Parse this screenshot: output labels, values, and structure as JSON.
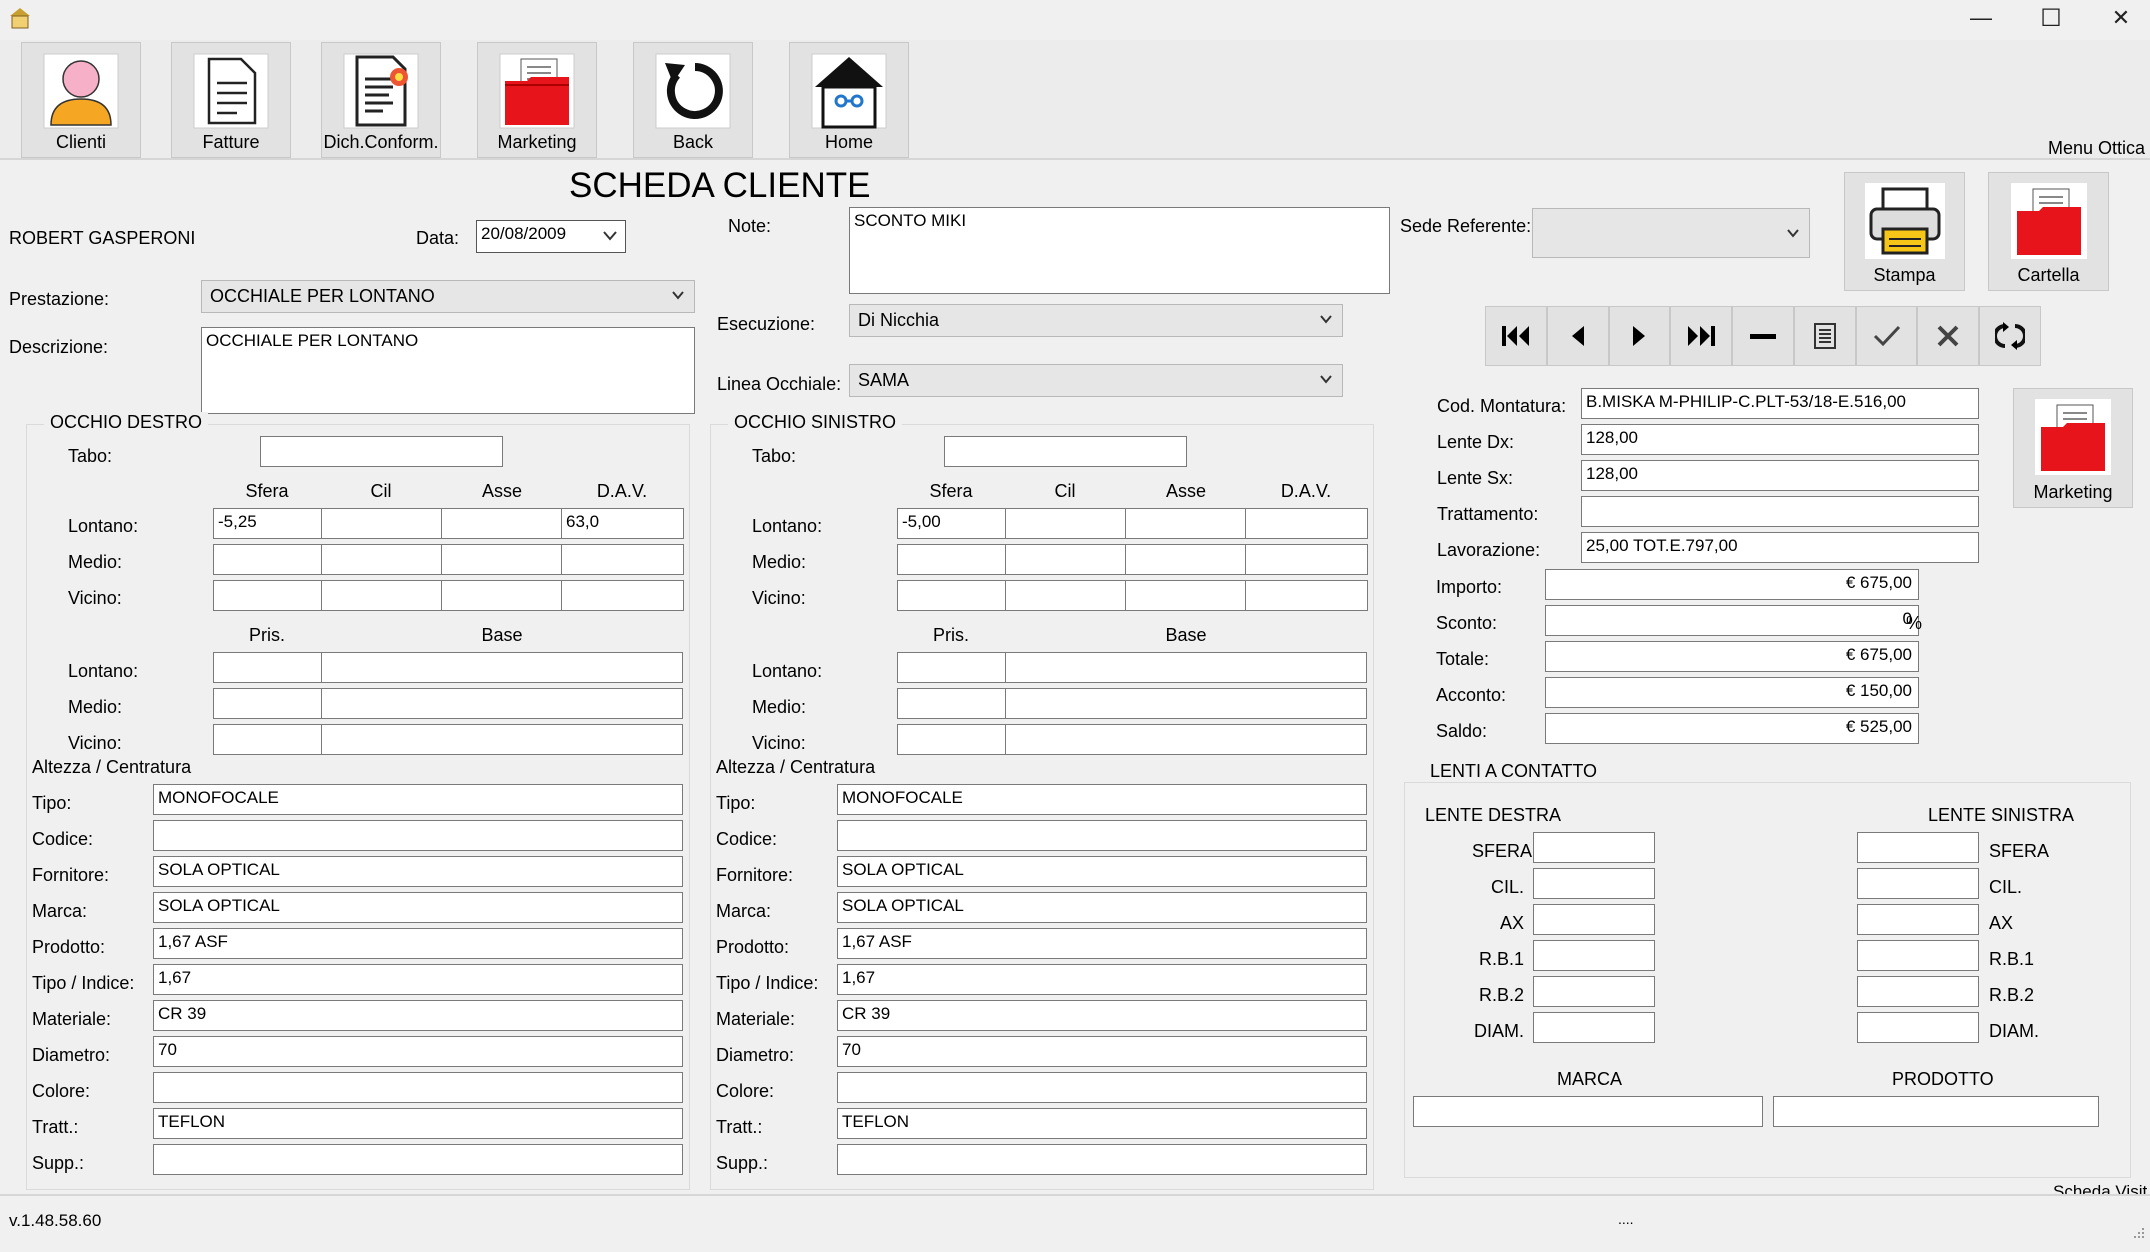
{
  "window": {
    "minimize": "—",
    "maximize": "☐",
    "close": "✕"
  },
  "toolbar": {
    "items": [
      {
        "label": "Clienti",
        "icon": "person-icon"
      },
      {
        "label": "Fatture",
        "icon": "document-icon"
      },
      {
        "label": "Dich.Conform.",
        "icon": "certificate-icon"
      },
      {
        "label": "Marketing",
        "icon": "folder-icon"
      },
      {
        "label": "Back",
        "icon": "undo-icon"
      },
      {
        "label": "Home",
        "icon": "home-icon"
      }
    ],
    "menu_label": "Menu Ottica"
  },
  "header": {
    "title": "SCHEDA CLIENTE",
    "customer": "ROBERT GASPERONI",
    "data_label": "Data:",
    "data_value": "20/08/2009",
    "note_label": "Note:",
    "note_value": "SCONTO MIKI",
    "sede_label": "Sede Referente:",
    "sede_value": ""
  },
  "prestazione": {
    "label": "Prestazione:",
    "value": "OCCHIALE PER LONTANO",
    "desc_label": "Descrizione:",
    "desc_value": "OCCHIALE PER LONTANO"
  },
  "esecuzione": {
    "label": "Esecuzione:",
    "value": "Di Nicchia"
  },
  "linea": {
    "label": "Linea Occhiale:",
    "value": "SAMA"
  },
  "buttons": {
    "stampa": "Stampa",
    "cartella": "Cartella",
    "marketing": "Marketing"
  },
  "eye_common": {
    "tabo": "Tabo:",
    "cols": [
      "Sfera",
      "Cil",
      "Asse",
      "D.A.V."
    ],
    "rows": [
      "Lontano:",
      "Medio:",
      "Vicino:"
    ],
    "cols2": [
      "Pris.",
      "Base"
    ],
    "altezza": "Altezza / Centratura",
    "fields": [
      "Tipo:",
      "Codice:",
      "Fornitore:",
      "Marca:",
      "Prodotto:",
      "Tipo / Indice:",
      "Materiale:",
      "Diametro:",
      "Colore:",
      "Tratt.:",
      "Supp.:"
    ]
  },
  "right_eye": {
    "title": "OCCHIO DESTRO",
    "tabo": "",
    "grid": [
      [
        "-5,25",
        "",
        "",
        "63,0"
      ],
      [
        "",
        "",
        "",
        ""
      ],
      [
        "",
        "",
        "",
        ""
      ]
    ],
    "grid2": [
      [
        "",
        ""
      ],
      [
        "",
        ""
      ],
      [
        "",
        ""
      ]
    ],
    "values": [
      "MONOFOCALE",
      "",
      "SOLA OPTICAL",
      "SOLA OPTICAL",
      "1,67 ASF",
      "1,67",
      "CR 39",
      "70",
      "",
      "TEFLON",
      ""
    ]
  },
  "left_eye": {
    "title": "OCCHIO SINISTRO",
    "tabo": "",
    "grid": [
      [
        "-5,00",
        "",
        "",
        ""
      ],
      [
        "",
        "",
        "",
        ""
      ],
      [
        "",
        "",
        "",
        ""
      ]
    ],
    "grid2": [
      [
        "",
        ""
      ],
      [
        "",
        ""
      ],
      [
        "",
        ""
      ]
    ],
    "values": [
      "MONOFOCALE",
      "",
      "SOLA OPTICAL",
      "SOLA OPTICAL",
      "1,67 ASF",
      "1,67",
      "CR 39",
      "70",
      "",
      "TEFLON",
      ""
    ]
  },
  "summary": {
    "labels": [
      "Cod. Montatura:",
      "Lente Dx:",
      "Lente Sx:",
      "Trattamento:",
      "Lavorazione:"
    ],
    "values": [
      "B.MISKA M-PHILIP-C.PLT-53/18-E.516,00",
      "128,00",
      "128,00",
      "",
      "25,00 TOT.E.797,00"
    ],
    "money_labels": [
      "Importo:",
      "Sconto:",
      "Totale:",
      "Acconto:",
      "Saldo:"
    ],
    "money_values": [
      "€ 675,00",
      "0",
      "€ 675,00",
      "€ 150,00",
      "€ 525,00"
    ],
    "percent": "%"
  },
  "contatto": {
    "title": "LENTI A CONTATTO",
    "dx_title": "LENTE DESTRA",
    "sx_title": "LENTE SINISTRA",
    "fields": [
      "SFERA",
      "CIL.",
      "AX",
      "R.B.1",
      "R.B.2",
      "DIAM."
    ],
    "marca": "MARCA",
    "prodotto": "PRODOTTO",
    "marca_value": "",
    "prodotto_value": ""
  },
  "status": {
    "version": "v.1.48.58.60",
    "dots": "....",
    "scheda": "Scheda Visit"
  }
}
